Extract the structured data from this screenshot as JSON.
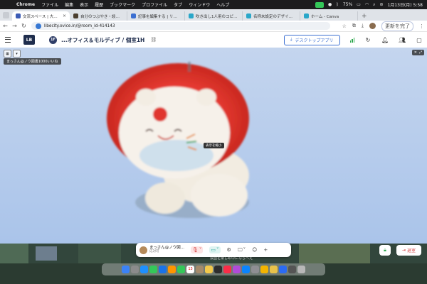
{
  "menubar": {
    "app": "Chrome",
    "items": [
      "ファイル",
      "編集",
      "表示",
      "履歴",
      "ブックマーク",
      "プロファイル",
      "タブ",
      "ウィンドウ",
      "ヘルプ"
    ],
    "battery": "75%",
    "datetime": "1月13日(月) 5:58"
  },
  "tabs": [
    {
      "label": "交流スペース | 大阪オフィ",
      "color": "#3b5bb5",
      "active": true
    },
    {
      "label": "自分のつぶやき・談笑 | リベシ",
      "color": "#4b3f2f",
      "active": false
    },
    {
      "label": "記事を編集する | リベシティ",
      "color": "#3b6fd1",
      "active": false
    },
    {
      "label": "吹き出し1人用のコピー - 600 ×",
      "color": "#2aa7c9",
      "active": false
    },
    {
      "label": "名称未設定のデザイン - 600 ×",
      "color": "#2aa7c9",
      "active": false
    },
    {
      "label": "ホーム - Canva",
      "color": "#2aa7c9",
      "active": false
    }
  ],
  "address": {
    "url": "libecity.ovice.in/@room_id-414143",
    "restart_label": "更新を完了"
  },
  "header": {
    "logo": "LB",
    "floor": "1F",
    "title": "...オフィス＆モルディブ / 個室1H",
    "download_label": "デスクトップアプリ"
  },
  "stage": {
    "name_tag": "まっさん@ノウ図書1000いいね",
    "tooltip": "表示を縮小"
  },
  "control_bar": {
    "user_name": "まっさん@ノウ図...",
    "user_status": "応対可"
  },
  "exit_label": "退室",
  "map_notice": "会話を楽しめ中にならべえ",
  "colors": {
    "accent": "#3b6fd1",
    "brand_navy": "#1f2d4d",
    "danger": "#d64545",
    "success": "#2fa84f"
  }
}
